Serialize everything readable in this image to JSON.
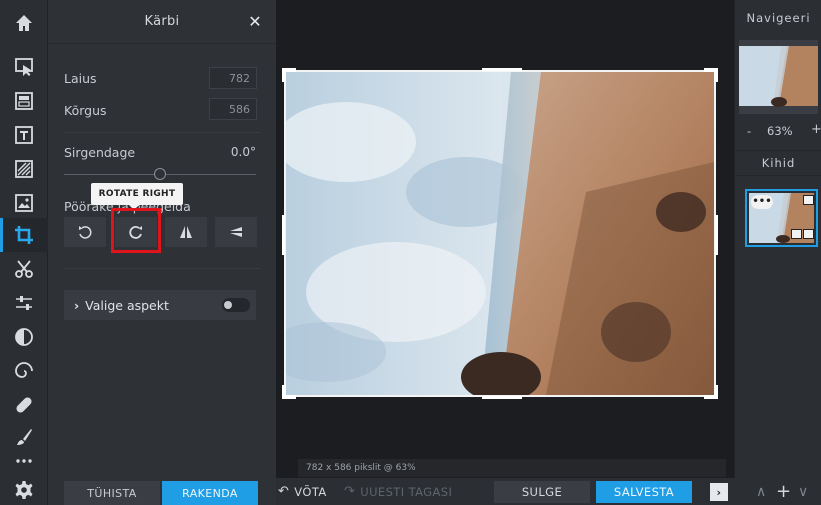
{
  "toolbar": {
    "tools": [
      {
        "name": "home",
        "icon": "home-icon"
      },
      {
        "name": "arrange",
        "icon": "cursor-icon"
      },
      {
        "name": "layout",
        "icon": "layout-icon"
      },
      {
        "name": "text",
        "icon": "text-icon"
      },
      {
        "name": "texture",
        "icon": "texture-icon"
      },
      {
        "name": "image",
        "icon": "image-icon"
      },
      {
        "name": "crop",
        "icon": "crop-icon",
        "active": true
      },
      {
        "name": "cutout",
        "icon": "scissors-icon"
      },
      {
        "name": "adjust",
        "icon": "sliders-icon"
      },
      {
        "name": "effects",
        "icon": "contrast-icon"
      },
      {
        "name": "liquify",
        "icon": "spiral-icon"
      },
      {
        "name": "heal",
        "icon": "bandage-icon"
      },
      {
        "name": "brush",
        "icon": "brush-icon"
      },
      {
        "name": "more",
        "icon": "more-icon"
      },
      {
        "name": "settings",
        "icon": "gear-icon"
      }
    ]
  },
  "panel": {
    "title": "Kärbi",
    "width_label": "Laius",
    "width_value": "782",
    "height_label": "Kõrgus",
    "height_value": "586",
    "straighten_label": "Sirgendage",
    "straighten_value": "0.0°",
    "straighten_level": 0.5,
    "rotate_label": "Pöörake ja peegelda",
    "tooltip": "ROTATE RIGHT",
    "aspect_label": "Valige aspekt",
    "aspect_enabled": false,
    "cancel_label": "TÜHISTA",
    "apply_label": "RAKENDA"
  },
  "canvas": {
    "info": "782 x 586 pikslit @ 63%"
  },
  "bottombar": {
    "undo_label": "VÕTA",
    "redo_label": "UUESTI TAGASI",
    "close_label": "SULGE",
    "save_label": "SALVESTA"
  },
  "rightpanel": {
    "navigator_title": "Navigeeri",
    "zoom_minus": "-",
    "zoom_value": "63%",
    "zoom_plus": "+",
    "layers_title": "Kihid"
  },
  "colors": {
    "accent": "#1f9ee6",
    "highlight": "#e0141b"
  }
}
